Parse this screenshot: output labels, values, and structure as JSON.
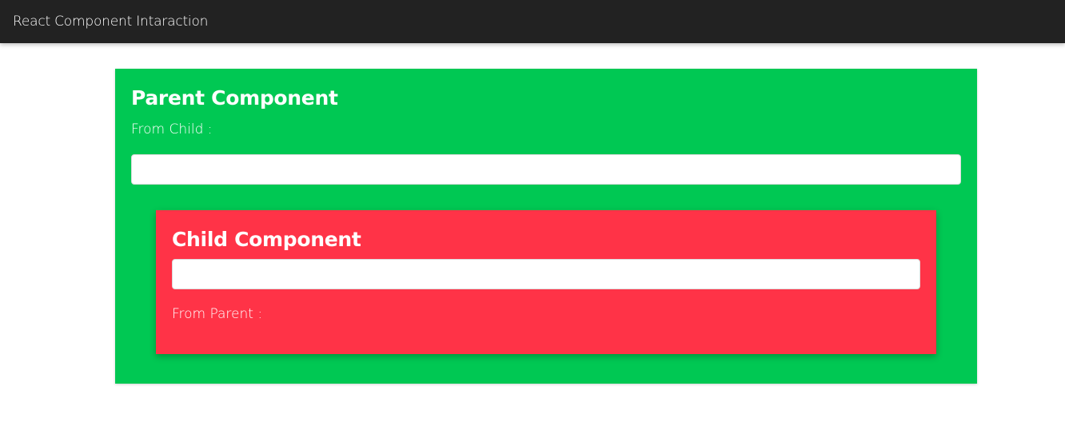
{
  "navbar": {
    "brand": "React Component Intaraction"
  },
  "parent": {
    "title": "Parent Component",
    "from_label": "From Child :",
    "from_value": "",
    "input_value": "",
    "input_placeholder": "",
    "bg_color": "#00c853"
  },
  "child": {
    "title": "Child Component",
    "input_value": "",
    "input_placeholder": "",
    "from_label": "From Parent :",
    "from_value": "",
    "bg_color": "#ff3347"
  }
}
